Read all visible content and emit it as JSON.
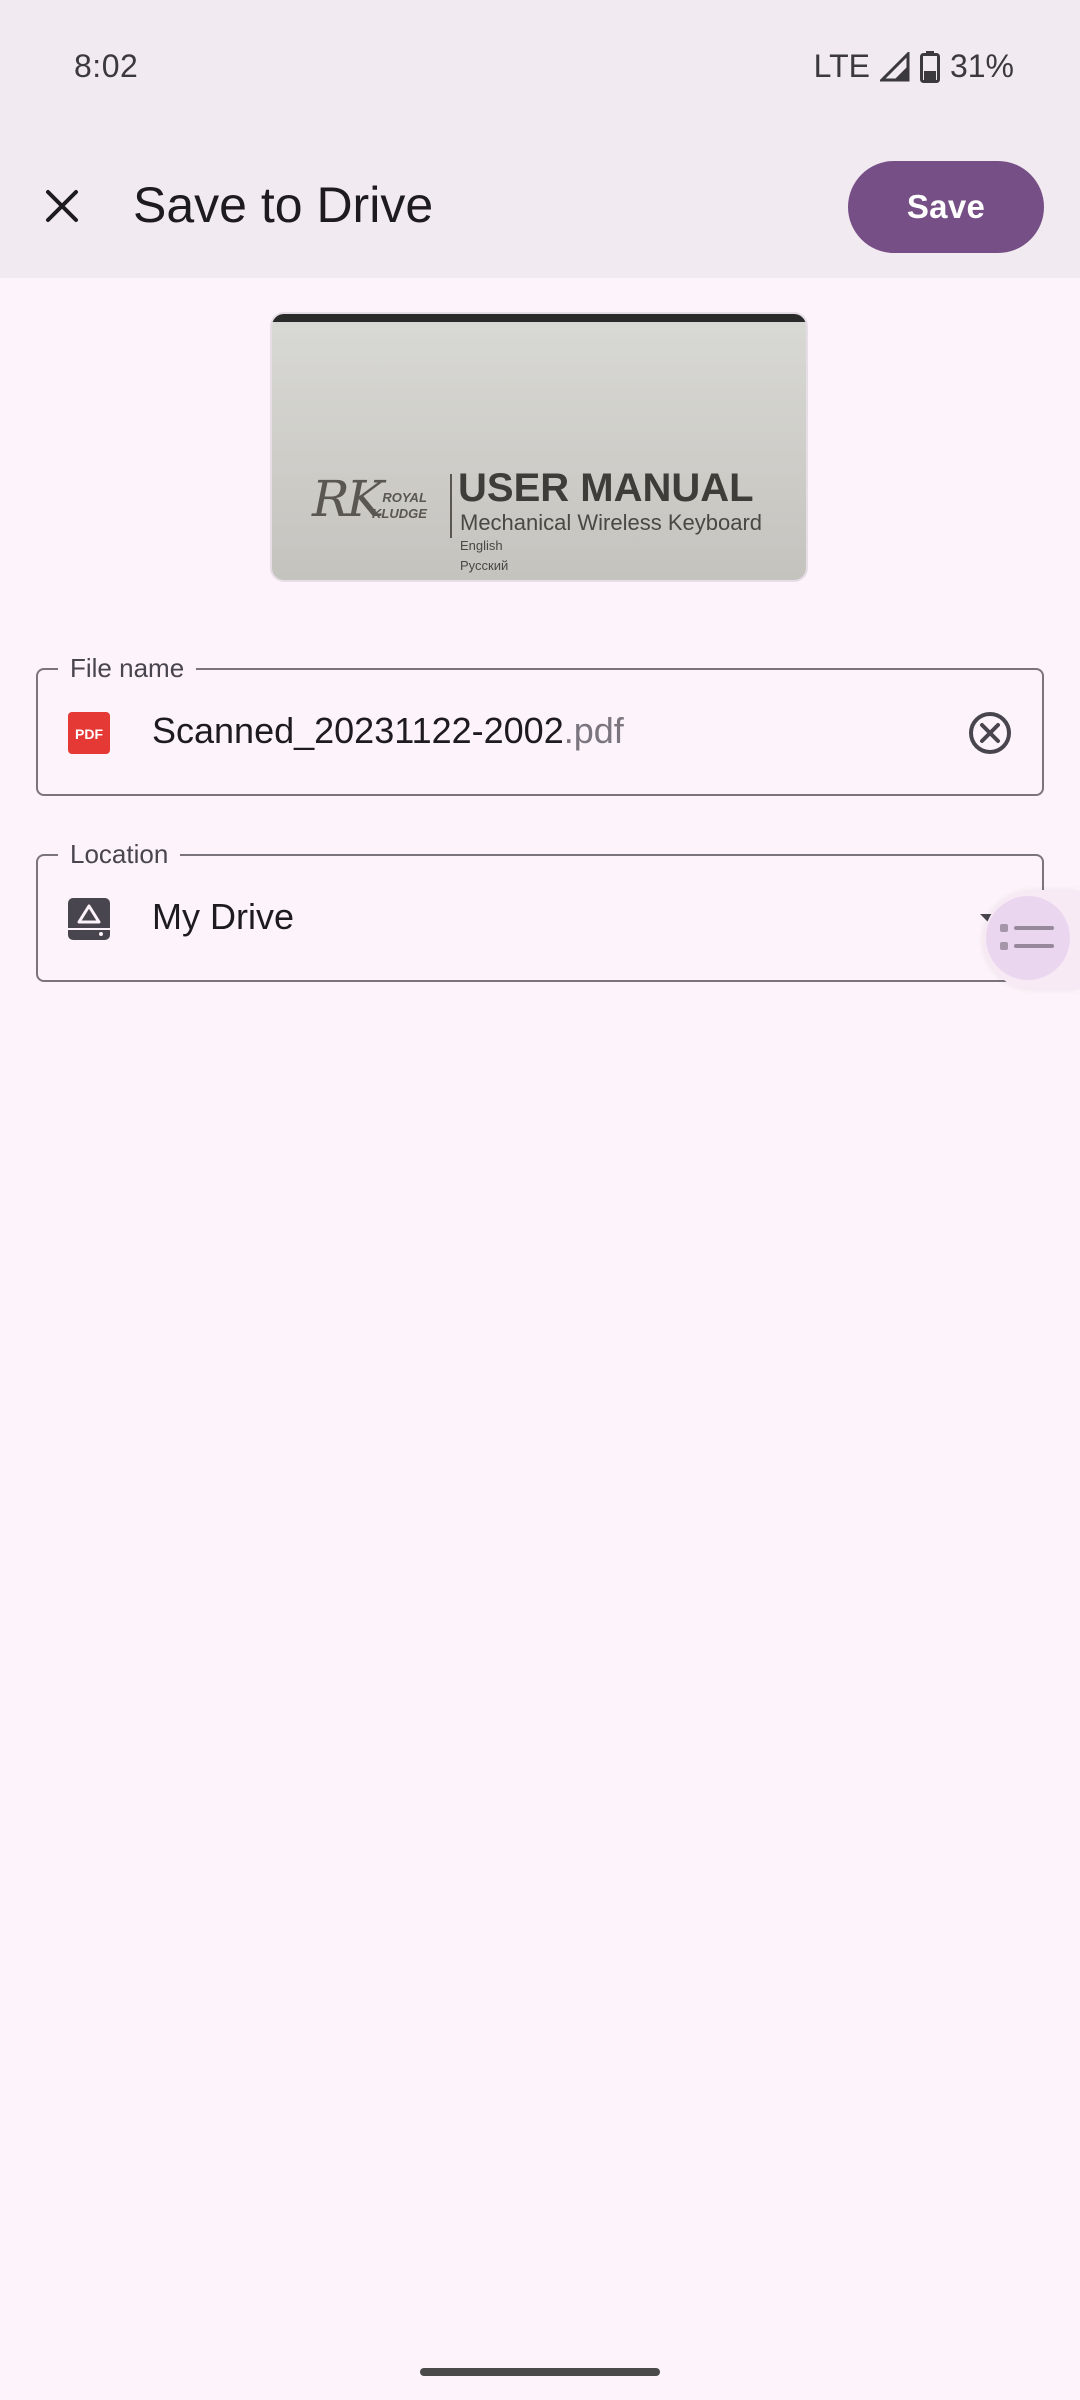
{
  "status_bar": {
    "time": "8:02",
    "network": "LTE",
    "battery": "31%"
  },
  "app_bar": {
    "title": "Save to Drive",
    "save_label": "Save",
    "close_icon": "close-icon"
  },
  "preview": {
    "logo": "RK",
    "brand_line1": "ROYAL",
    "brand_line2": "KLUDGE",
    "heading": "USER MANUAL",
    "subheading": "Mechanical Wireless Keyboard",
    "languages": [
      "English",
      "Русский"
    ]
  },
  "file_name_field": {
    "label": "File name",
    "value": "Scanned_20231122-2002",
    "extension": ".pdf",
    "icon": "pdf-file-icon",
    "icon_text": "PDF",
    "icon_color": "#e53935"
  },
  "location_field": {
    "label": "Location",
    "value": "My Drive",
    "icon": "drive-icon"
  },
  "colors": {
    "accent": "#754f85",
    "surface": "#fdf3fa",
    "app_bar": "#f2eaf1"
  }
}
